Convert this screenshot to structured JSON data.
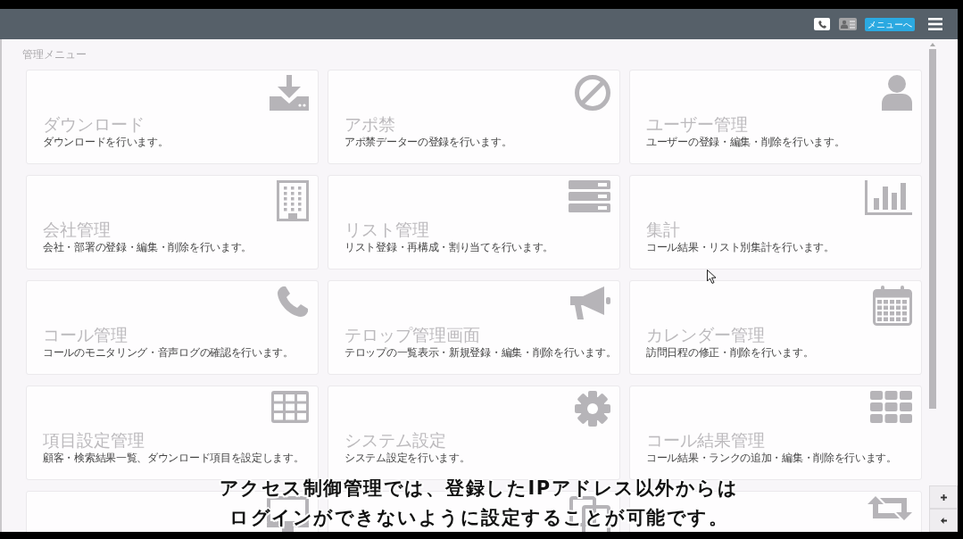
{
  "header": {
    "menu_button": "メニューへ"
  },
  "section_title": "管理メニュー",
  "tiles": [
    {
      "kind": "menu",
      "title": "ダウンロード",
      "description": "ダウンロードを行います。"
    },
    {
      "kind": "menu",
      "title": "アポ禁",
      "description": "アポ禁データーの登録を行います。"
    },
    {
      "kind": "menu",
      "title": "ユーザー管理",
      "description": "ユーザーの登録・編集・削除を行います。"
    },
    {
      "kind": "menu",
      "title": "会社管理",
      "description": "会社・部署の登録・編集・削除を行います。"
    },
    {
      "kind": "menu",
      "title": "リスト管理",
      "description": "リスト登録・再構成・割り当てを行います。"
    },
    {
      "kind": "menu",
      "title": "集計",
      "description": "コール結果・リスト別集計を行います。"
    },
    {
      "kind": "menu",
      "title": "コール管理",
      "description": "コールのモニタリング・音声ログの確認を行います。"
    },
    {
      "kind": "menu",
      "title": "テロップ管理画面",
      "description": "テロップの一覧表示・新規登録・編集・削除を行います。"
    },
    {
      "kind": "menu",
      "title": "カレンダー管理",
      "description": "訪問日程の修正・削除を行います。"
    },
    {
      "kind": "menu",
      "title": "項目設定管理",
      "description": "顧客・検索結果一覧、ダウンロード項目を設定します。"
    },
    {
      "kind": "menu",
      "title": "システム設定",
      "description": "システム設定を行います。"
    },
    {
      "kind": "menu",
      "title": "コール結果管理",
      "description": "コール結果・ランクの追加・編集・削除を行います。"
    },
    {
      "kind": "partial"
    },
    {
      "kind": "partial"
    },
    {
      "kind": "partial"
    }
  ],
  "subtitles": [
    "アクセス制御管理では、登録したIPアドレス以外からは",
    "ログインができないように設定することが可能です。"
  ]
}
